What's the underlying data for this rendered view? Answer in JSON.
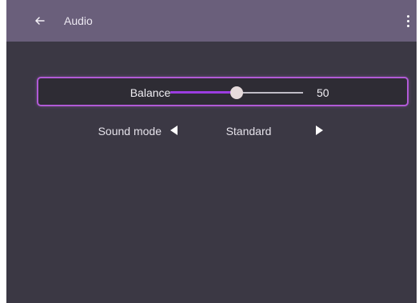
{
  "header": {
    "title": "Audio",
    "back_icon": "arrow-left-icon",
    "more_icon": "more-vertical-icon"
  },
  "settings": {
    "balance": {
      "label": "Balance",
      "value": "50",
      "fraction": 0.5
    },
    "sound_mode": {
      "label": "Sound mode",
      "value": "Standard",
      "prev_icon": "triangle-left-icon",
      "next_icon": "triangle-right-icon"
    }
  },
  "colors": {
    "background": "#3b3844",
    "header": "#6a5f7b",
    "accent": "#9b3de0",
    "focus_border": "#b15ad6",
    "text": "#f0eef3"
  }
}
